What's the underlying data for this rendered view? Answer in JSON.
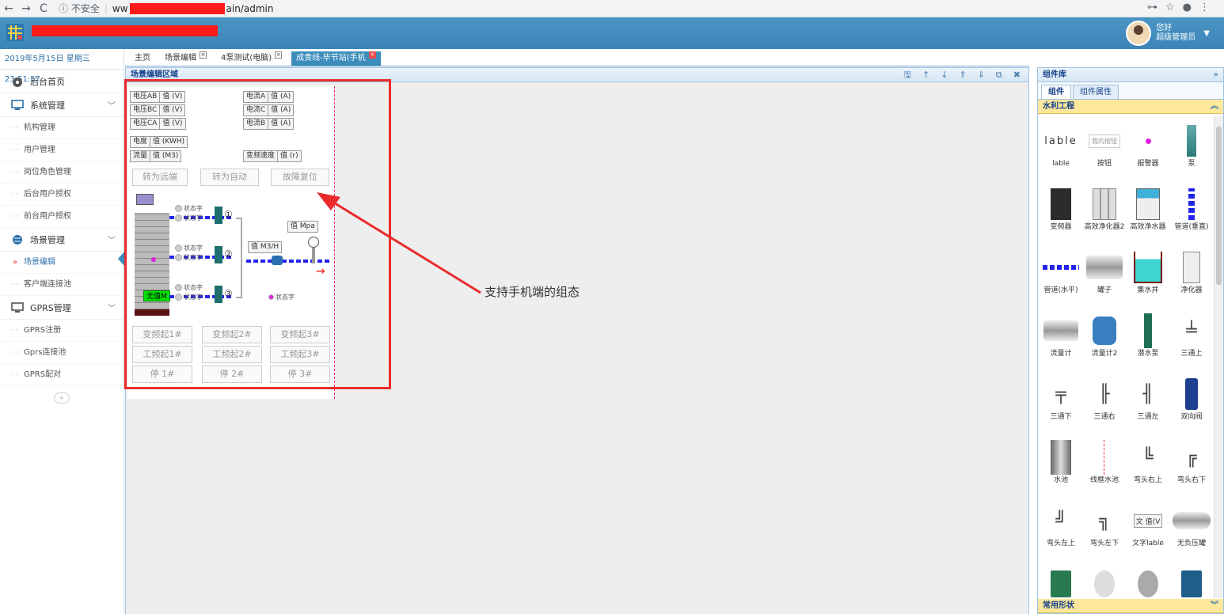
{
  "browser": {
    "back": "←",
    "forward": "→",
    "reload": "C",
    "security": "ⓘ 不安全",
    "url_prefix": "ww",
    "url_suffix": "ain/admin"
  },
  "header": {
    "greeting": "您好",
    "user_role": "超级管理员",
    "caret": "▼"
  },
  "sidebar": {
    "datetime": "2019年5月15日 星期三23:51:57",
    "home": "后台首页",
    "sys": {
      "label": "系统管理",
      "items": [
        "机构管理",
        "用户管理",
        "岗位角色管理",
        "后台用户授权",
        "前台用户授权"
      ]
    },
    "scene": {
      "label": "场景管理",
      "items": [
        "场景编辑",
        "客户端连接池"
      ]
    },
    "gprs": {
      "label": "GPRS管理",
      "items": [
        "GPRS注册",
        "Gprs连接池",
        "GPRS配对"
      ]
    },
    "collapse": "»"
  },
  "tabs": [
    {
      "label": "主页",
      "closable": false
    },
    {
      "label": "场景编辑",
      "closable": true
    },
    {
      "label": "4泵测试(电脑)",
      "closable": true
    },
    {
      "label": "成贵线-毕节站(手机",
      "closable": true,
      "active": true
    }
  ],
  "editor": {
    "title": "场景编辑区域",
    "toolbar": [
      "🖫",
      "↑",
      "↓",
      "⇑",
      "⇓",
      "⧉",
      "✖"
    ]
  },
  "scene": {
    "vboxes": [
      {
        "k": "电压AB",
        "v": "值 (V)"
      },
      {
        "k": "电压BC",
        "v": "值 (V)"
      },
      {
        "k": "电压CA",
        "v": "值 (V)"
      },
      {
        "k": "电流A",
        "v": "值 (A)"
      },
      {
        "k": "电流C",
        "v": "值 (A)"
      },
      {
        "k": "电流B",
        "v": "值 (A)"
      },
      {
        "k": "电度",
        "v": "值 (KWH)"
      },
      {
        "k": "流量",
        "v": "值 (M3)"
      },
      {
        "k": "变频速度",
        "v": "值 (r)"
      }
    ],
    "buttons_top": [
      "转为远端",
      "转为自动",
      "故障复位"
    ],
    "buttons_bottom": [
      "变频起1#",
      "变频起2#",
      "变频起3#",
      "工频起1#",
      "工频起2#",
      "工频起3#",
      "停 1#",
      "停 2#",
      "停 3#"
    ],
    "status": "状态字",
    "pressure": "值 Mpa",
    "flow": "值 M3/H",
    "green": "无值M",
    "nums": [
      "①",
      "②",
      "③"
    ]
  },
  "annotation": "支持手机端的组态",
  "right": {
    "title": "组件库",
    "expand": "»",
    "tabs": [
      "组件",
      "组件属性"
    ],
    "section1": "水利工程",
    "section2": "常用形状",
    "components": [
      "lable",
      "按钮",
      "报警器",
      "泵",
      "变频器",
      "高效净化器2",
      "高效净水器",
      "管道(垂直)",
      "管道(水平)",
      "罐子",
      "集水井",
      "净化器",
      "流量计",
      "流量计2",
      "潜水泵",
      "三通上",
      "三通下",
      "三通右",
      "三通左",
      "双向阀",
      "水池",
      "线框水池",
      "弯头右上",
      "弯头右下",
      "弯头左上",
      "弯头左下",
      "文字lable",
      "无负压罐"
    ],
    "lable_sample": "lable",
    "btn_sample": "我的按钮",
    "text_sample": "文 值(V"
  }
}
